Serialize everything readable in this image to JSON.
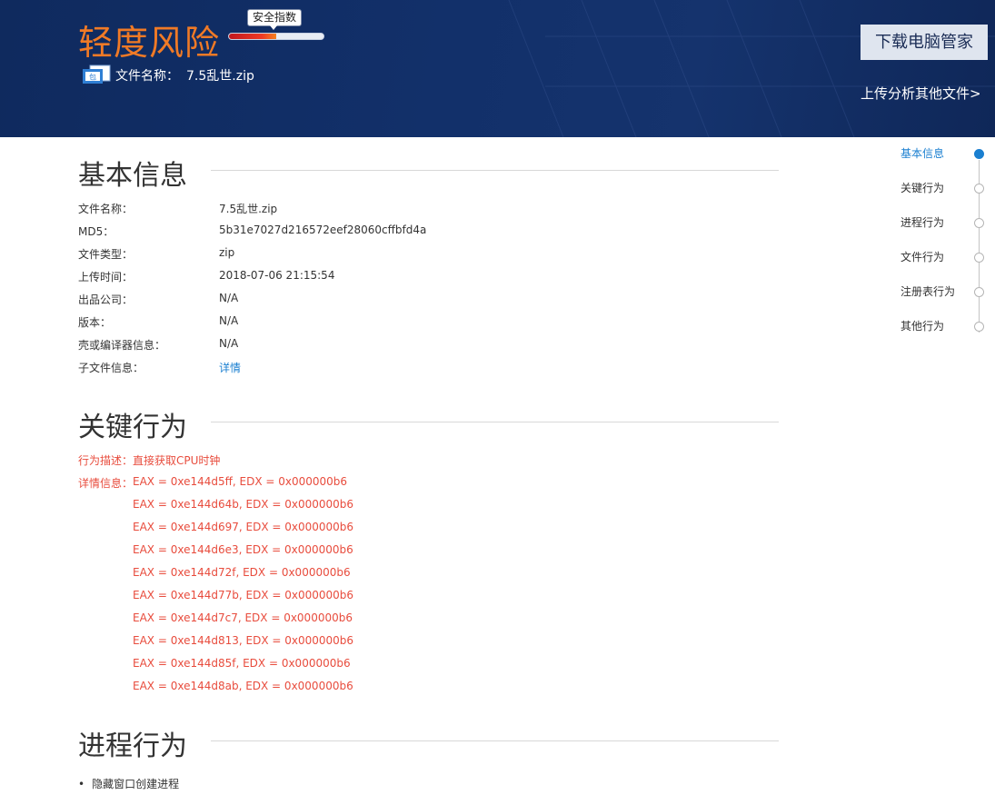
{
  "header": {
    "risk_level": "轻度风险",
    "safety_index_label": "安全指数",
    "safety_index_fraction": 0.5,
    "file_label": "文件名称：",
    "file_name": "7.5乱世.zip",
    "file_icon_glyph": "包",
    "download_button": "下载电脑管家",
    "upload_link": "上传分析其他文件>"
  },
  "basic_info": {
    "title": "基本信息",
    "rows": [
      {
        "label": "文件名称：",
        "value": "7.5乱世.zip"
      },
      {
        "label": "MD5：",
        "value": "5b31e7027d216572eef28060cffbfd4a"
      },
      {
        "label": "文件类型：",
        "value": "zip"
      },
      {
        "label": "上传时间：",
        "value": "2018-07-06 21:15:54"
      },
      {
        "label": "出品公司：",
        "value": "N/A"
      },
      {
        "label": "版本：",
        "value": "N/A"
      },
      {
        "label": "壳或编译器信息：",
        "value": "N/A"
      },
      {
        "label": "子文件信息：",
        "value": "详情"
      }
    ]
  },
  "key_behavior": {
    "title": "关键行为",
    "desc_label": "行为描述：",
    "desc_value": "直接获取CPU时钟",
    "detail_label": "详情信息：",
    "details": [
      "EAX = 0xe144d5ff, EDX = 0x000000b6",
      "EAX = 0xe144d64b, EDX = 0x000000b6",
      "EAX = 0xe144d697, EDX = 0x000000b6",
      "EAX = 0xe144d6e3, EDX = 0x000000b6",
      "EAX = 0xe144d72f, EDX = 0x000000b6",
      "EAX = 0xe144d77b, EDX = 0x000000b6",
      "EAX = 0xe144d7c7, EDX = 0x000000b6",
      "EAX = 0xe144d813, EDX = 0x000000b6",
      "EAX = 0xe144d85f, EDX = 0x000000b6",
      "EAX = 0xe144d8ab, EDX = 0x000000b6"
    ]
  },
  "process_behavior": {
    "title": "进程行为",
    "items": [
      "隐藏窗口创建进程"
    ]
  },
  "nav": {
    "items": [
      "基本信息",
      "关键行为",
      "进程行为",
      "文件行为",
      "注册表行为",
      "其他行为"
    ],
    "active_index": 0
  },
  "colors": {
    "banner": "#12306a",
    "risk_orange": "#f07a26",
    "alert_red": "#e84c3d",
    "link_blue": "#1a7fd0"
  }
}
